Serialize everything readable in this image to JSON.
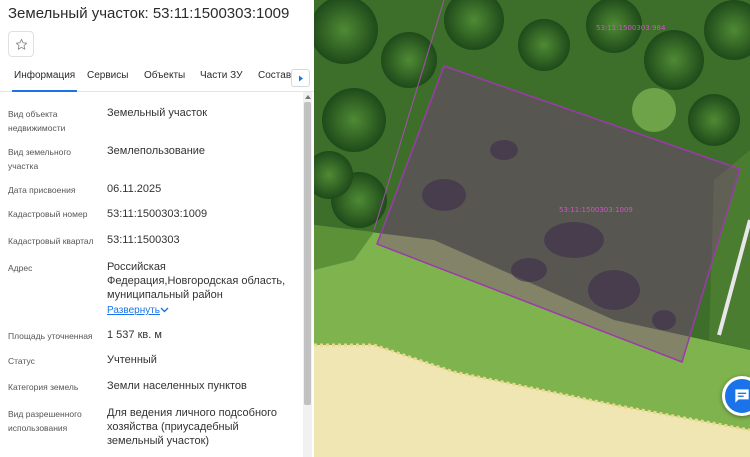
{
  "header": {
    "title": "Земельный участок: 53:11:1500303:1009"
  },
  "favorite": {
    "icon": "star-outline-icon"
  },
  "tabs": [
    {
      "label": "Информация",
      "active": true
    },
    {
      "label": "Сервисы",
      "active": false
    },
    {
      "label": "Объекты",
      "active": false
    },
    {
      "label": "Части ЗУ",
      "active": false
    },
    {
      "label": "Состав",
      "active": false
    }
  ],
  "info": {
    "object_type": {
      "label": "Вид объекта недвижимости",
      "value": "Земельный участок"
    },
    "land_type": {
      "label": "Вид земельного участка",
      "value": "Землепользование"
    },
    "assign_date": {
      "label": "Дата присвоения",
      "value": "06.11.2025"
    },
    "cadastral_number": {
      "label": "Кадастровый номер",
      "value": "53:11:1500303:1009"
    },
    "cadastral_block": {
      "label": "Кадастровый квартал",
      "value": "53:11:1500303"
    },
    "address": {
      "label": "Адрес",
      "value": "Российская Федерация,Новгородская область, муниципальный район",
      "expand_label": "Развернуть"
    },
    "area": {
      "label": "Площадь уточненная",
      "value": "1 537 кв. м"
    },
    "status": {
      "label": "Статус",
      "value": "Учтенный"
    },
    "category": {
      "label": "Категория земель",
      "value": "Земли населенных пунктов"
    },
    "permitted_use": {
      "label": "Вид разрешенного использования",
      "value": "Для ведения личного подсобного хозяйства (приусадебный земельный участок)"
    }
  },
  "map": {
    "parcel_label": "53:11:1500303:1009",
    "neighbor_label": "53:11:1500303:984",
    "parcel_color": "#8b2a9b",
    "fab_icon": "chat-icon"
  }
}
